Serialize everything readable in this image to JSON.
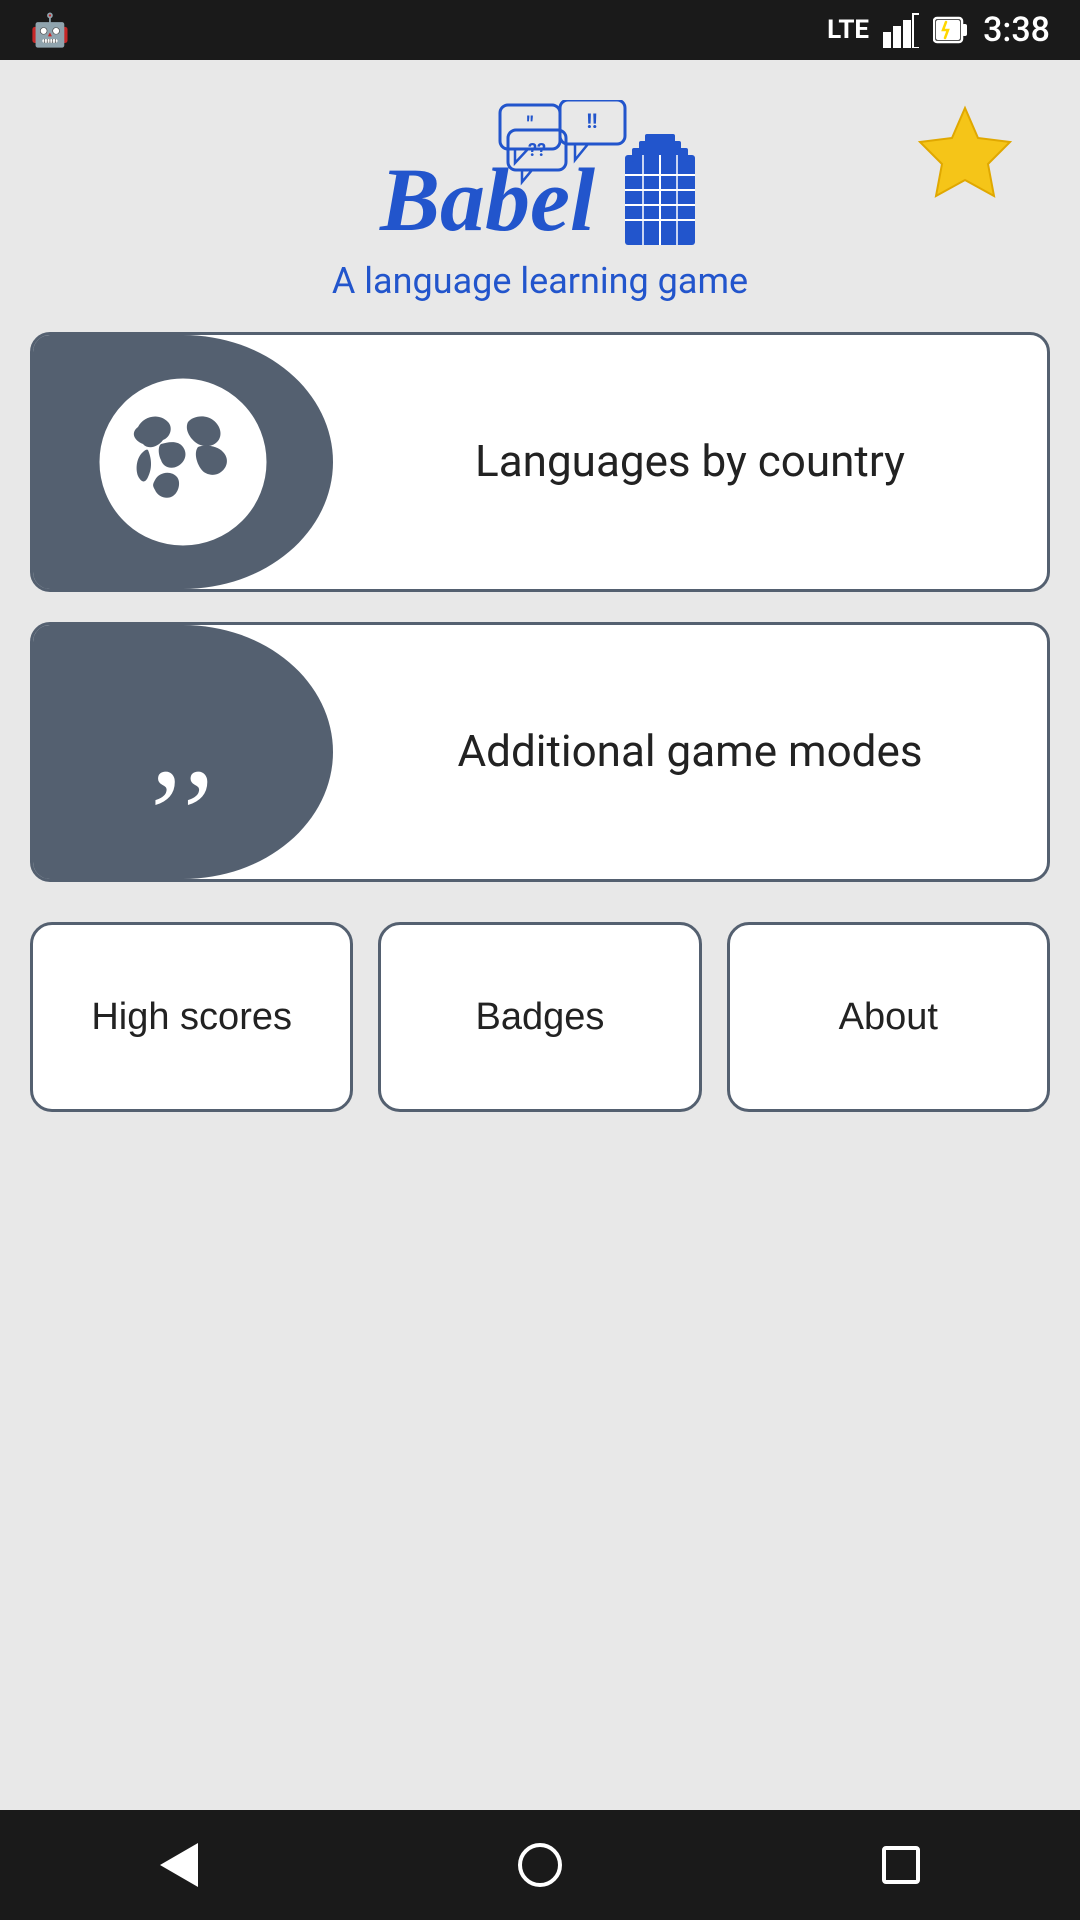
{
  "status_bar": {
    "time": "3:38",
    "lte_label": "LTE",
    "app_icon": "🤖"
  },
  "header": {
    "subtitle": "A language learning game",
    "star_label": "★"
  },
  "game_cards": [
    {
      "id": "languages-by-country",
      "label": "Languages by\ncountry",
      "icon_type": "globe"
    },
    {
      "id": "additional-game-modes",
      "label": "Additional game modes",
      "icon_type": "quotes"
    }
  ],
  "bottom_buttons": [
    {
      "id": "high-scores",
      "label": "High scores"
    },
    {
      "id": "badges",
      "label": "Badges"
    },
    {
      "id": "about",
      "label": "About"
    }
  ],
  "nav": {
    "back_label": "back",
    "home_label": "home",
    "recents_label": "recents"
  }
}
